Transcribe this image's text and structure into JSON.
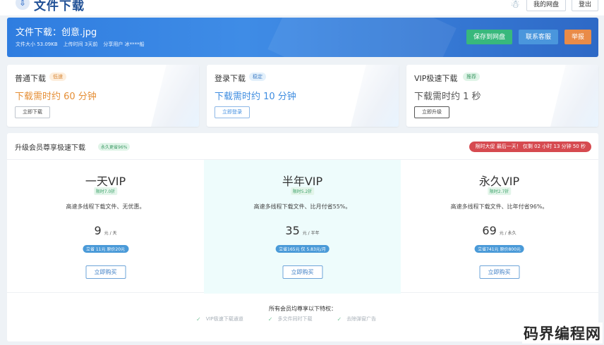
{
  "header": {
    "logo_glyph": "⇩",
    "title": "文件下载",
    "avatar_glyph": "☃",
    "my_drive": "我的网盘",
    "logout": "登出"
  },
  "file": {
    "title": "文件下载：创意.jpg",
    "size": "文件大小 53.09KB",
    "upload_time": "上传时间 3天前",
    "sharer": "分享用户 冰****船"
  },
  "file_actions": {
    "save": "保存到网盘",
    "contact": "联系客服",
    "report": "举报"
  },
  "download_options": [
    {
      "name": "普通下载",
      "tag": "低速",
      "time": "下载需时约 60 分钟",
      "button": "立即下载"
    },
    {
      "name": "登录下载",
      "tag": "稳定",
      "time": "下载需时约 10 分钟",
      "button": "立即登录"
    },
    {
      "name": "VIP极速下载",
      "tag": "推荐",
      "time": "下载需时约 1 秒",
      "button": "立即升级"
    }
  ],
  "vip": {
    "title": "升级会员尊享极速下载",
    "tag": "永久更省96%",
    "countdown": "限时大促 最后一天！ 仅剩 02 小时 13 分钟 50 秒",
    "plans": [
      {
        "name": "一天VIP",
        "discount": "限时7.0折",
        "desc": "高速多线程下载文件、无优惠。",
        "price": "9",
        "unit": "元 / 天",
        "save": "立省 11元 原价20元",
        "button": "立即购买"
      },
      {
        "name": "半年VIP",
        "discount": "限时5.2折",
        "desc": "高速多线程下载文件、比月付省55%。",
        "price": "35",
        "unit": "元 / 半年",
        "save": "立省165元 仅 5.83元/月",
        "button": "立即购买"
      },
      {
        "name": "永久VIP",
        "discount": "限时2.7折",
        "desc": "高速多线程下载文件、比年付省96%。",
        "price": "69",
        "unit": "元 / 永久",
        "save": "立省741元 原价800元",
        "button": "立即购买"
      }
    ],
    "perks_title": "所有会员均尊享以下特权：",
    "perks": [
      "VIP极速下载通道",
      "多文件同时下载",
      "去除弹窗广告"
    ]
  },
  "watermark": "码界编程网",
  "colors": {
    "banner": "#2f7de0",
    "save_button": "#38b87c",
    "contact_button": "#4a96dc",
    "report_button": "#e98b48",
    "countdown": "#d64a50",
    "highlight_plan": "#eefcfc"
  }
}
